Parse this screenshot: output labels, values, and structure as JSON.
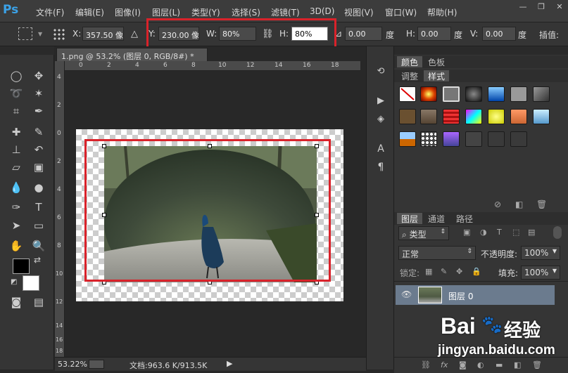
{
  "menu": {
    "logo": "Ps",
    "items": [
      "文件(F)",
      "编辑(E)",
      "图像(I)",
      "图层(L)",
      "类型(Y)",
      "选择(S)",
      "滤镜(T)",
      "3D(D)",
      "视图(V)",
      "窗口(W)",
      "帮助(H)"
    ]
  },
  "window_controls": {
    "minimize": "—",
    "restore": "❐",
    "close": "✕"
  },
  "options_bar": {
    "x_label": "X:",
    "x_value": "357.50 像",
    "y_label": "Y:",
    "y_value": "230.00 像",
    "w_label": "W:",
    "w_value": "80%",
    "h_label": "H:",
    "h_value": "80%",
    "angle_value": "0.00",
    "angle_unit": "度",
    "hskew_label": "H:",
    "hskew_value": "0.00",
    "hskew_unit": "度",
    "vskew_label": "V:",
    "vskew_value": "0.00",
    "vskew_unit": "度",
    "interp_label": "插值:"
  },
  "document": {
    "tab_title": "1.png @ 53.2% (图层 0, RGB/8#) *",
    "ruler_top": [
      "0",
      "2",
      "4",
      "6",
      "8",
      "10",
      "12",
      "14",
      "16",
      "18"
    ],
    "ruler_left": [
      "4",
      "2",
      "0",
      "2",
      "4",
      "6",
      "8",
      "10",
      "12",
      "14",
      "16",
      "18"
    ],
    "zoom": "53.22%",
    "status": "文档:963.6 K/913.5K"
  },
  "panels": {
    "top_tabs": [
      "颜色",
      "色板"
    ],
    "style_tabs": [
      "调整",
      "样式"
    ],
    "layer_tabs": [
      "图层",
      "通道",
      "路径"
    ],
    "filter_kind": "类型",
    "blend_mode": "正常",
    "opacity_label": "不透明度:",
    "opacity_value": "100%",
    "lock_label": "锁定:",
    "fill_label": "填充:",
    "fill_value": "100%",
    "layer_name": "图层 0"
  },
  "watermark": {
    "brand": "Bai",
    "brand2": "经验",
    "url": "jingyan.baidu.com"
  },
  "colors": {
    "ps_blue": "#3ba2e8",
    "highlight_red": "#d9222a",
    "layer_selected": "#6b7b8e"
  }
}
